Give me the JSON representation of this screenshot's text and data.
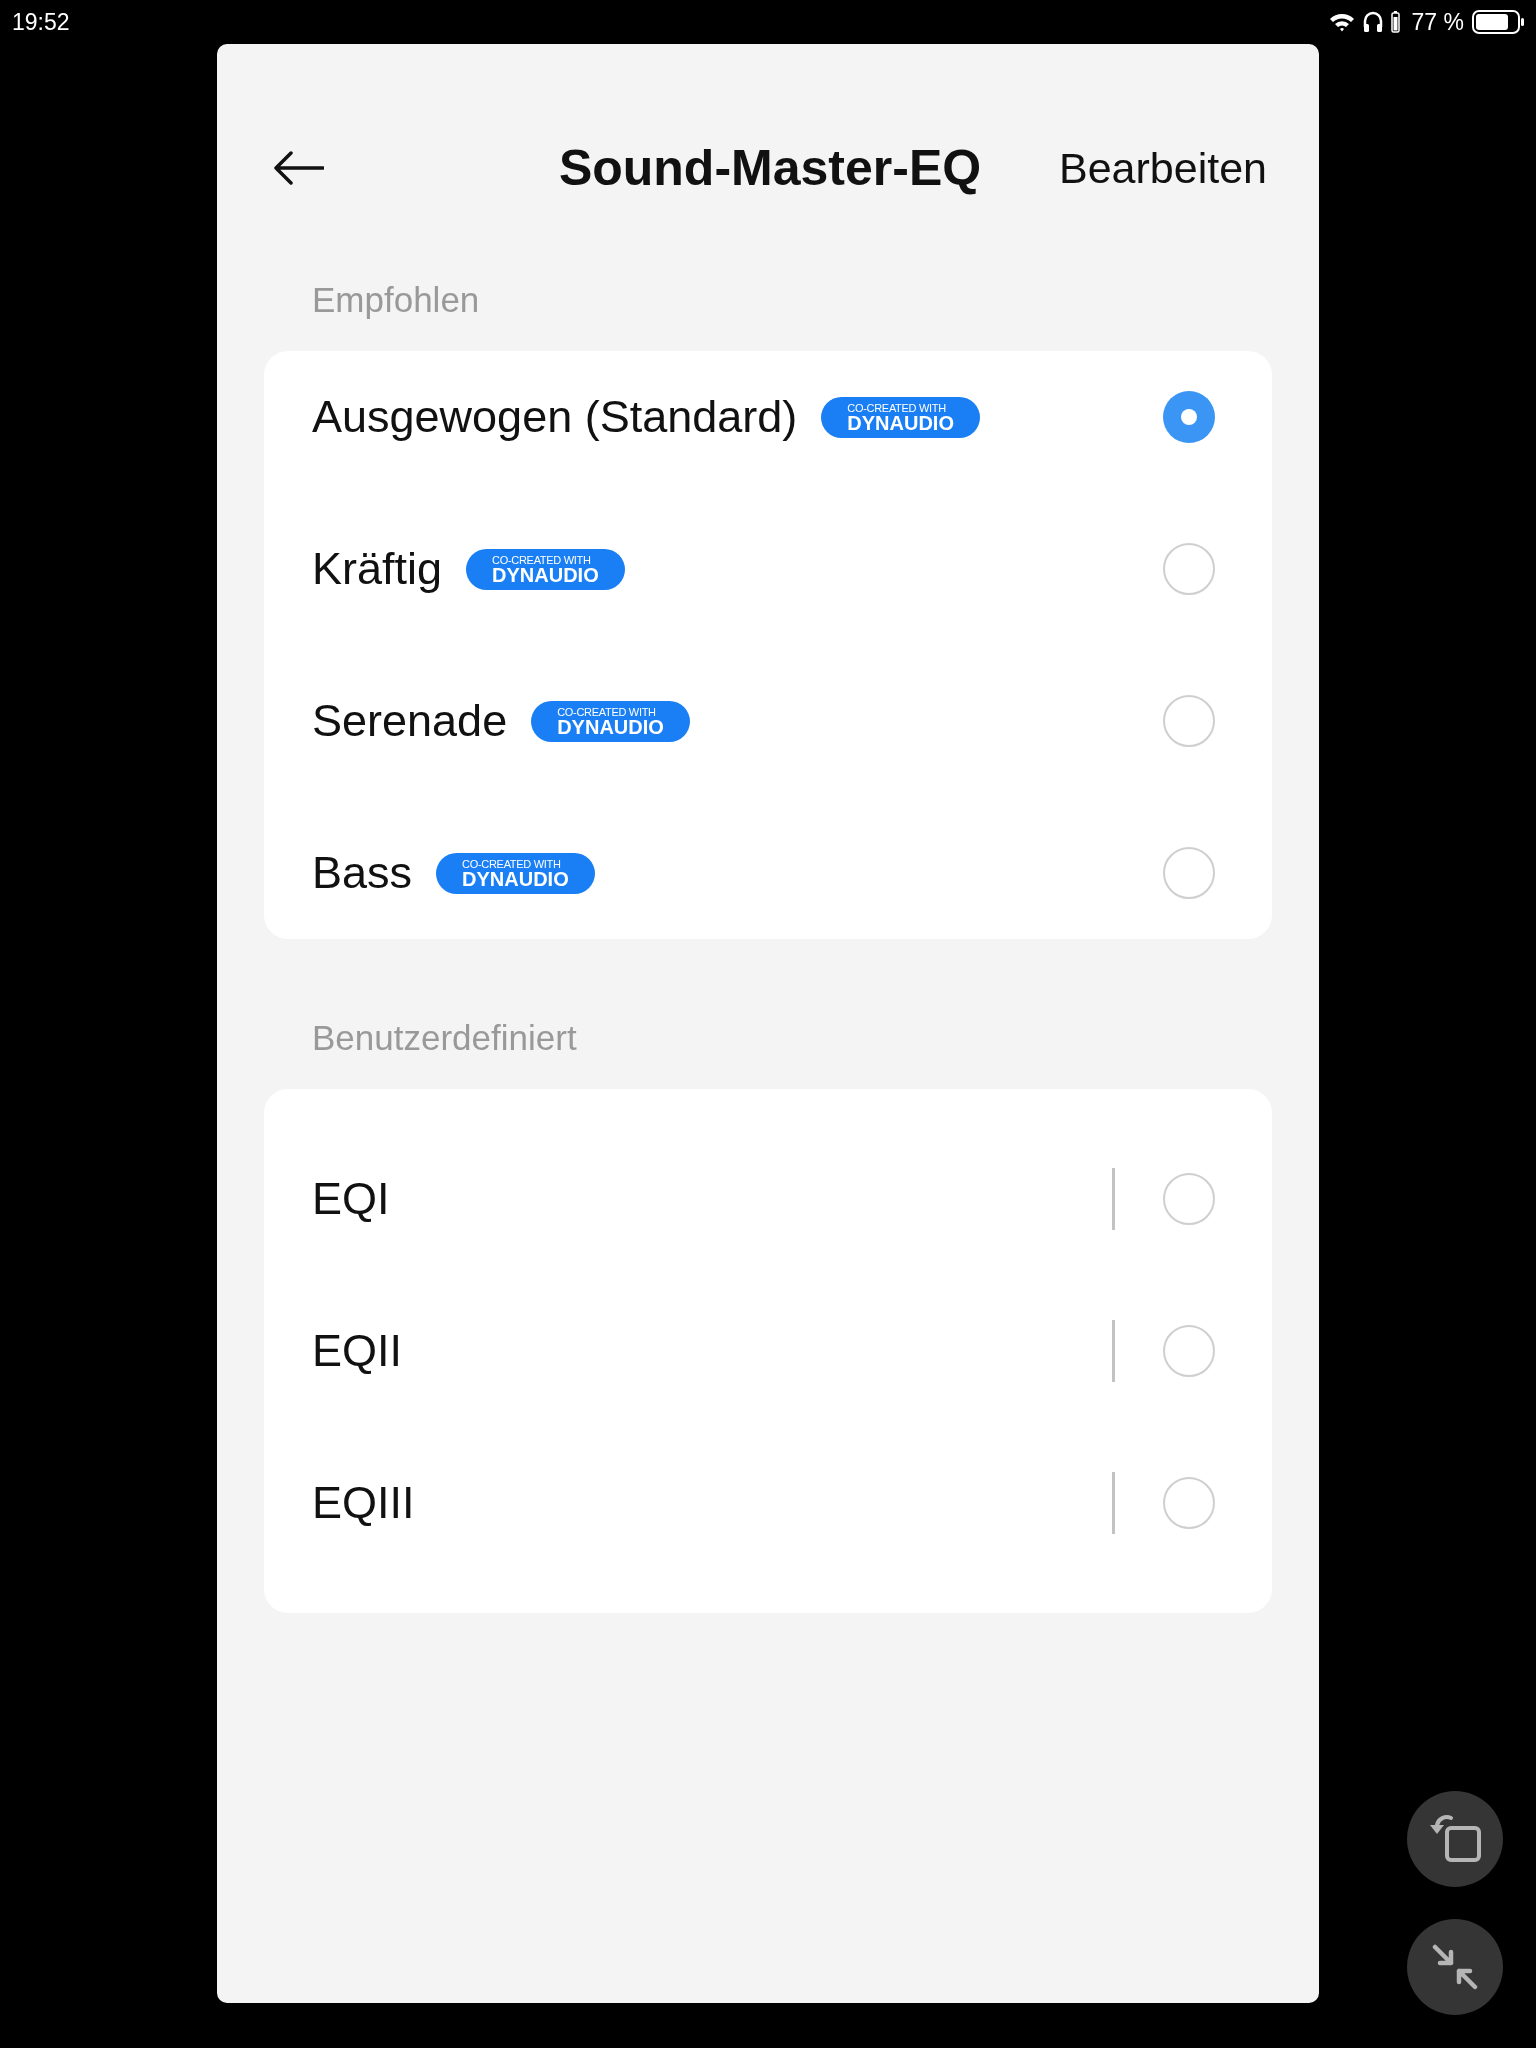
{
  "status_bar": {
    "time": "19:52",
    "battery": "77 %"
  },
  "header": {
    "title": "Sound-Master-EQ",
    "action": "Bearbeiten"
  },
  "sections": [
    {
      "title": "Empfohlen",
      "kind": "preset",
      "items": [
        {
          "label": "Ausgewogen (Standard)",
          "badge": {
            "caption": "CO-CREATED WITH",
            "brand": "DYNAUDIO"
          },
          "selected": true
        },
        {
          "label": "Kräftig",
          "badge": {
            "caption": "CO-CREATED WITH",
            "brand": "DYNAUDIO"
          },
          "selected": false
        },
        {
          "label": "Serenade",
          "badge": {
            "caption": "CO-CREATED WITH",
            "brand": "DYNAUDIO"
          },
          "selected": false
        },
        {
          "label": "Bass",
          "badge": {
            "caption": "CO-CREATED WITH",
            "brand": "DYNAUDIO"
          },
          "selected": false
        }
      ]
    },
    {
      "title": "Benutzerdefiniert",
      "kind": "custom",
      "items": [
        {
          "label": "EQI",
          "selected": false
        },
        {
          "label": "EQII",
          "selected": false
        },
        {
          "label": "EQIII",
          "selected": false
        }
      ]
    }
  ]
}
